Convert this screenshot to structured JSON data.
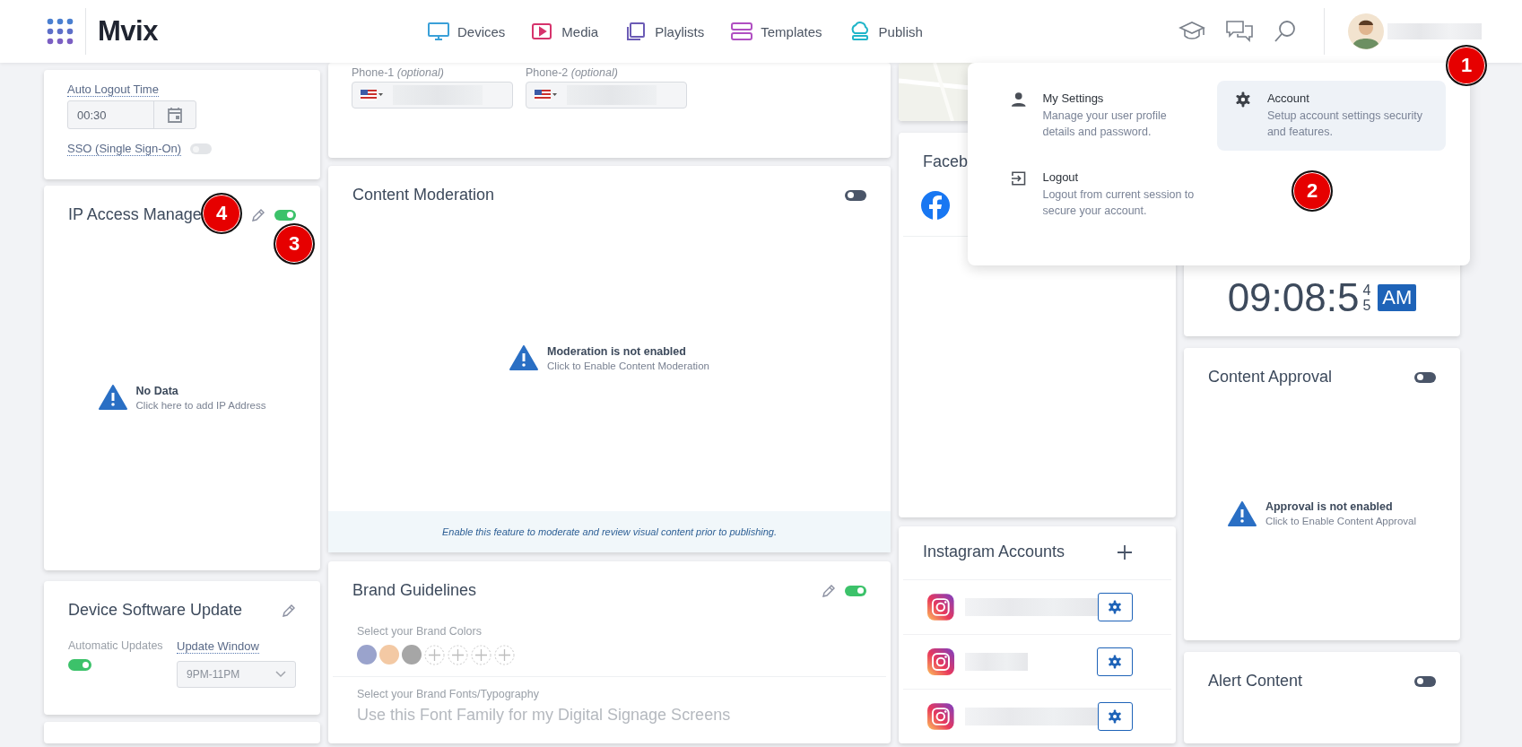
{
  "header": {
    "logo": "Mvix",
    "nav": [
      {
        "label": "Devices",
        "kind": "devices"
      },
      {
        "label": "Media",
        "kind": "media"
      },
      {
        "label": "Playlists",
        "kind": "playlists"
      },
      {
        "label": "Templates",
        "kind": "templates"
      },
      {
        "label": "Publish",
        "kind": "publish"
      }
    ]
  },
  "security_card": {
    "auto_logout_label": "Auto Logout Time",
    "auto_logout_value": "00:30",
    "sso_label": "SSO (Single Sign-On)",
    "sso_on": false,
    "sso_disabled": true
  },
  "ip_access": {
    "title": "IP Access Manage",
    "enabled": true,
    "empty_title": "No Data",
    "empty_hint": "Click here to add IP Address"
  },
  "software_update": {
    "title": "Device Software Update",
    "auto_label": "Automatic Updates",
    "auto_on": true,
    "window_label": "Update Window",
    "window_value": "9PM-11PM"
  },
  "contact_card": {
    "phones": [
      {
        "label": "Phone-1 *(optional)*"
      },
      {
        "label": "Phone-2 *(optional)*"
      }
    ]
  },
  "moderation": {
    "title": "Content Moderation",
    "enabled": false,
    "empty_title": "Moderation is not enabled",
    "empty_hint": "Click to Enable Content Moderation",
    "footer": "Enable this feature to moderate and review visual content prior to publishing."
  },
  "brand": {
    "title": "Brand Guidelines",
    "enabled": true,
    "colors_label": "Select your Brand Colors",
    "swatches": [
      {
        "kind": "color",
        "color": "#9aa3cc"
      },
      {
        "kind": "color",
        "color": "#f3c9a4"
      },
      {
        "kind": "color",
        "color": "#a6a6a6"
      },
      {
        "kind": "empty"
      },
      {
        "kind": "empty"
      },
      {
        "kind": "empty"
      },
      {
        "kind": "empty"
      }
    ],
    "fonts_label": "Select your Brand Fonts/Typography",
    "font_placeholder": "Use this Font Family for my Digital Signage Screens"
  },
  "map": {
    "kind": "picture"
  },
  "facebook": {
    "title": "Faceb"
  },
  "instagram": {
    "title": "Instagram Accounts",
    "accounts": [
      {
        "kind": "account"
      },
      {
        "kind": "account"
      },
      {
        "kind": "account"
      }
    ]
  },
  "clock": {
    "time": "09:08:5",
    "rolling_digits": [
      "4",
      "5"
    ],
    "period": "AM"
  },
  "approval": {
    "title": "Content Approval",
    "enabled": false,
    "empty_title": "Approval is not enabled",
    "empty_hint": "Click to Enable Content Approval"
  },
  "alert": {
    "title": "Alert Content",
    "enabled": false
  },
  "user_menu": {
    "items": [
      {
        "kind": "settings",
        "title": "My Settings",
        "description": "Manage your user profile details and password.",
        "selected": false
      },
      {
        "kind": "account",
        "title": "Account",
        "description": "Setup account settings security and features.",
        "selected": true
      },
      {
        "kind": "logout",
        "title": "Logout",
        "description": "Logout from current session to secure your account.",
        "selected": false
      }
    ]
  },
  "callouts": [
    "1",
    "2",
    "3",
    "4"
  ]
}
